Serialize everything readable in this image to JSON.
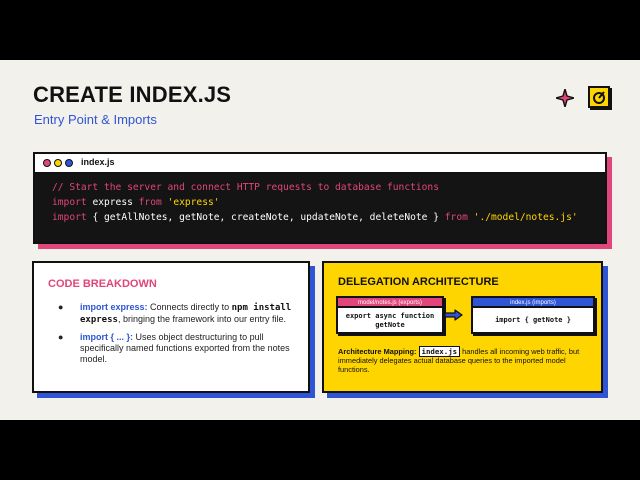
{
  "slide": {
    "title": "CREATE INDEX.JS",
    "subtitle": "Entry Point & Imports"
  },
  "icons": {
    "sparkle": "sparkle-icon",
    "logo": "gauge-logo-icon"
  },
  "colors": {
    "pink": "#e0457b",
    "blue": "#2f55d4",
    "yellow": "#ffd500",
    "dark": "#141414",
    "cream": "#f3f1ec"
  },
  "code": {
    "filename": "index.js",
    "comment": "// Start the server and connect HTTP requests to database functions",
    "line2": {
      "kw_import": "import",
      "ident": "express",
      "kw_from": "from",
      "str": "'express'"
    },
    "line3": {
      "kw_import": "import",
      "imports": "{ getAllNotes, getNote, createNote, updateNote, deleteNote }",
      "kw_from": "from",
      "str": "'./model/notes.js'"
    }
  },
  "breakdown": {
    "title": "CODE BREAKDOWN",
    "bullet": "●",
    "items": [
      {
        "label": "import express:",
        "t1": "Connects directly to",
        "code": "npm install express",
        "t2": ", bringing the framework into our entry file."
      },
      {
        "label": "import { ... }:",
        "t1": "Uses object destructuring to pull specifically named functions exported from the notes model."
      }
    ]
  },
  "delegation": {
    "title": "DELEGATION ARCHITECTURE",
    "export_box": {
      "header": "model/notes.js (exports)",
      "line1": "export async function",
      "line2": "getNote"
    },
    "import_box": {
      "header": "index.js (imports)",
      "line1": "import { getNote }"
    },
    "mapping": {
      "lead": "Architecture Mapping:",
      "code": "index.js",
      "text": "handles all incoming web traffic, but immediately delegates actual database queries to the imported model functions."
    }
  }
}
